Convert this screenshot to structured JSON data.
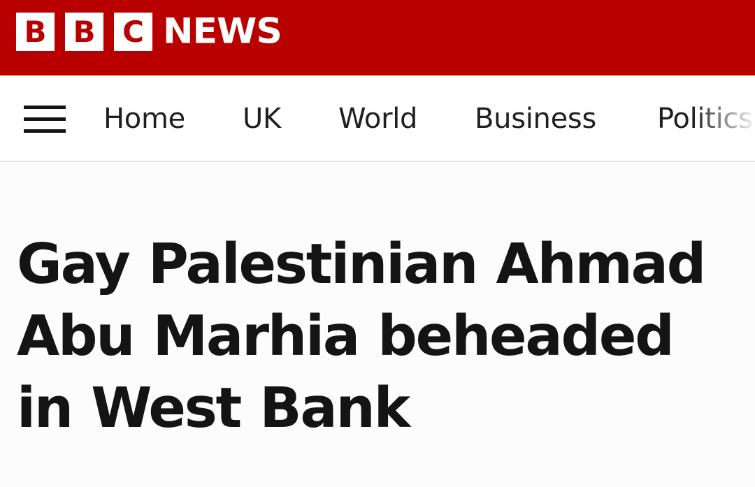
{
  "masthead": {
    "logo_letters": [
      "B",
      "B",
      "C"
    ],
    "logo_word": "NEWS",
    "brand_color": "#b80000"
  },
  "nav": {
    "menu_icon": "hamburger-menu-icon",
    "items": [
      {
        "label": "Home"
      },
      {
        "label": "UK"
      },
      {
        "label": "World"
      },
      {
        "label": "Business"
      },
      {
        "label": "Politics"
      }
    ]
  },
  "article": {
    "headline": "Gay Palestinian Ahmad Abu Marhia beheaded in West Bank"
  }
}
